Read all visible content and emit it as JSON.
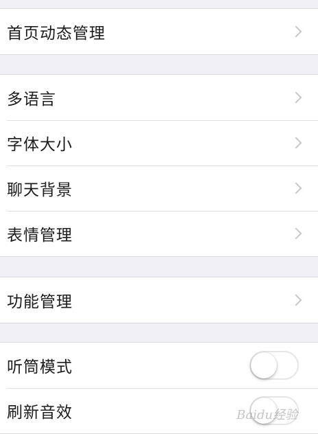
{
  "group1": {
    "items": [
      {
        "label": "首页动态管理"
      }
    ]
  },
  "group2": {
    "items": [
      {
        "label": "多语言"
      },
      {
        "label": "字体大小"
      },
      {
        "label": "聊天背景"
      },
      {
        "label": "表情管理"
      }
    ]
  },
  "group3": {
    "items": [
      {
        "label": "功能管理"
      }
    ]
  },
  "group4": {
    "items": [
      {
        "label": "听筒模式",
        "toggle": "off"
      },
      {
        "label": "刷新音效",
        "toggle": "off"
      }
    ]
  },
  "watermark": "Baidu经验"
}
